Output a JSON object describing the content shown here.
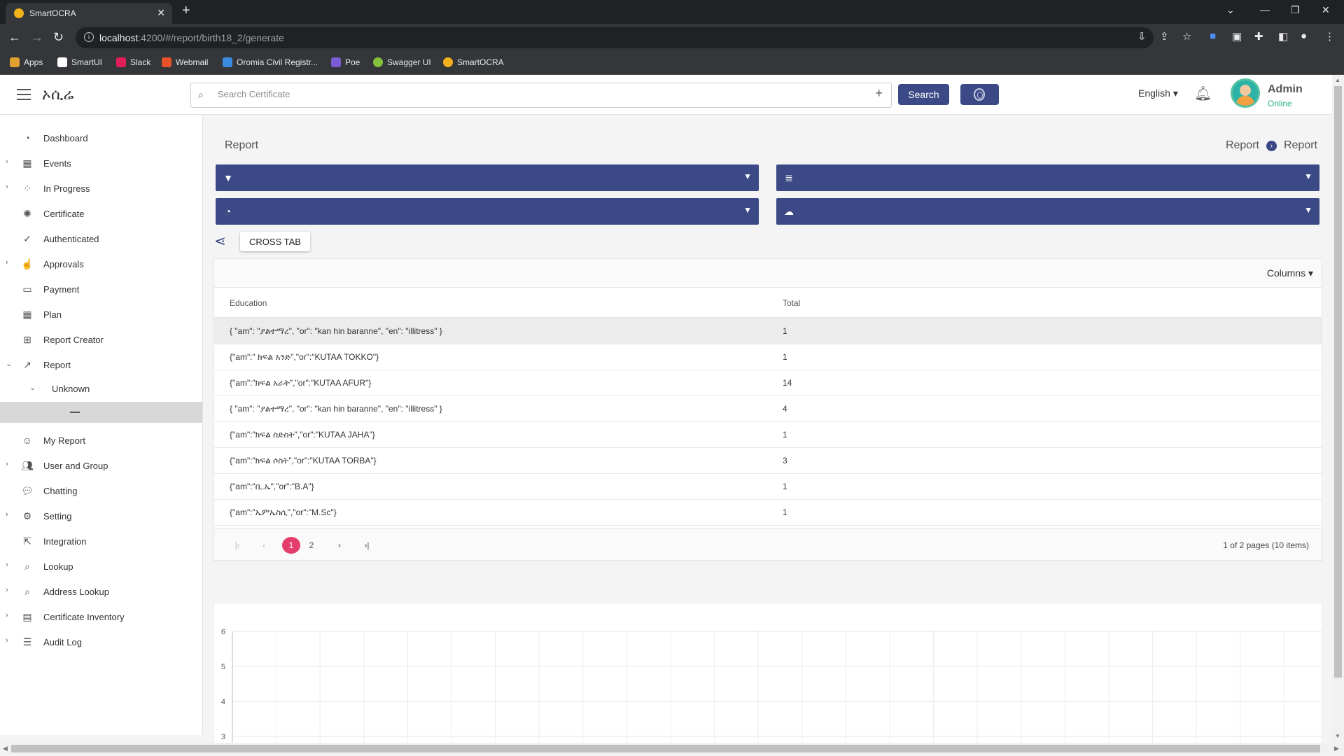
{
  "browser": {
    "tab_title": "SmartOCRA",
    "url_host": "localhost",
    "url_rest": ":4200/#/report/birth18_2/generate",
    "bookmarks": [
      "Apps",
      "SmartUI",
      "Slack",
      "Webmail",
      "Oromia Civil Registr...",
      "Poe",
      "Swagger UI",
      "SmartOCRA"
    ]
  },
  "header": {
    "brand": "ኦሲሬ",
    "search_placeholder": "Search Certificate",
    "search_button": "Search",
    "language": "English",
    "user_name": "Admin",
    "user_status": "Online"
  },
  "sidebar": {
    "items": [
      {
        "label": "Dashboard",
        "icon": "dashboard-icon",
        "expandable": false
      },
      {
        "label": "Events",
        "icon": "calendar-icon",
        "expandable": true
      },
      {
        "label": "In Progress",
        "icon": "spinner-icon",
        "expandable": true
      },
      {
        "label": "Certificate",
        "icon": "certificate-icon",
        "expandable": false
      },
      {
        "label": "Authenticated",
        "icon": "check-circle-icon",
        "expandable": false
      },
      {
        "label": "Approvals",
        "icon": "thumbs-up-icon",
        "expandable": true
      },
      {
        "label": "Payment",
        "icon": "credit-card-icon",
        "expandable": false
      },
      {
        "label": "Plan",
        "icon": "calendar-icon",
        "expandable": false
      },
      {
        "label": "Report Creator",
        "icon": "plus-square-icon",
        "expandable": false
      },
      {
        "label": "Report",
        "icon": "line-chart-icon",
        "expandable": true
      },
      {
        "label": "My Report",
        "icon": "smile-icon",
        "expandable": false
      },
      {
        "label": "User and Group",
        "icon": "users-icon",
        "expandable": true
      },
      {
        "label": "Chatting",
        "icon": "chat-icon",
        "expandable": false
      },
      {
        "label": "Setting",
        "icon": "gear-icon",
        "expandable": true
      },
      {
        "label": "Integration",
        "icon": "external-link-icon",
        "expandable": false
      },
      {
        "label": "Lookup",
        "icon": "search-plus-icon",
        "expandable": true
      },
      {
        "label": "Address Lookup",
        "icon": "search-plus-icon",
        "expandable": true
      },
      {
        "label": "Certificate Inventory",
        "icon": "archive-icon",
        "expandable": true
      },
      {
        "label": "Audit Log",
        "icon": "list-icon",
        "expandable": true
      }
    ],
    "sub_item": "Unknown"
  },
  "page": {
    "title": "Report",
    "breadcrumb": [
      "Report",
      "Report"
    ],
    "crosstab_button": "CROSS TAB"
  },
  "grid": {
    "columns_button": "Columns",
    "headers": [
      "Education",
      "Total"
    ],
    "rows": [
      [
        "{ \"am\": \"ያልተማረ\", \"or\": \"kan hin baranne\", \"en\": \"illitress\" }",
        "1"
      ],
      [
        "{\"am\":\" ክፍል አንድ\",\"or\":\"KUTAA TOKKO\"}",
        "1"
      ],
      [
        "{\"am\":\"ክፍል አራት\",\"or\":\"KUTAA AFUR\"}",
        "14"
      ],
      [
        "{ \"am\": \"ያልተማረ\", \"or\": \"kan hin baranne\", \"en\": \"illitress\" }",
        "4"
      ],
      [
        "{\"am\":\"ክፍል ስድስት\",\"or\":\"KUTAA JAHA\"}",
        "1"
      ],
      [
        "{\"am\":\"ክፍል ሶስት\",\"or\":\"KUTAA TORBA\"}",
        "3"
      ],
      [
        "{\"am\":\"ቢ.ኤ\",\"or\":\"B.A\"}",
        "1"
      ],
      [
        "{\"am\":\"ኤምኤስሲ\",\"or\":\"M.Sc\"}",
        "1"
      ]
    ],
    "pages": [
      "1",
      "2"
    ],
    "current_page": "1",
    "pager_info": "1 of 2 pages (10 items)"
  },
  "chart_data": {
    "type": "bar",
    "categories": [],
    "values": [],
    "y_ticks": [
      "6",
      "5",
      "4",
      "3"
    ],
    "grid": true
  },
  "colors": {
    "accent": "#3b4a86",
    "page_current": "#e33d6c",
    "online": "#2ab57d"
  }
}
